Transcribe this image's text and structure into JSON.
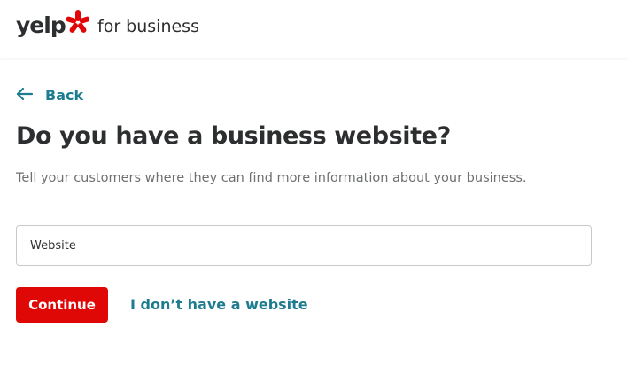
{
  "header": {
    "logo_text": "yelp",
    "tagline": "for business",
    "brand_color": "#e00707"
  },
  "nav": {
    "back_label": "Back",
    "back_icon": "arrow-left-icon",
    "link_color": "#1d7c8f"
  },
  "main": {
    "title": "Do you have a business website?",
    "subtitle": "Tell your customers where they can find more information about your business.",
    "website_field": {
      "placeholder": "Website",
      "value": ""
    },
    "continue_label": "Continue",
    "no_website_label": "I don’t have a website"
  }
}
